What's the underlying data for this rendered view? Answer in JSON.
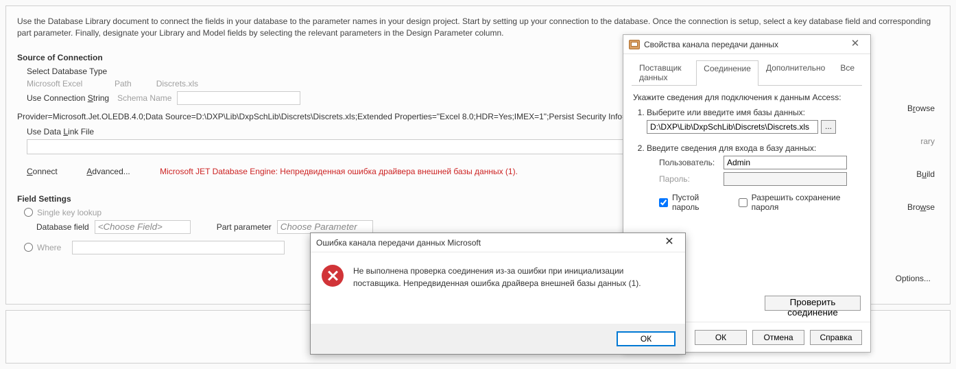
{
  "intro": "Use the Database Library document to connect the fields in your database to the parameter names in your design project. Start by setting up your connection to the database. Once the connection is setup, select a key database field and corresponding part parameter. Finally, designate your Library and Model fields by selecting the relevant parameters in the Design Parameter column.",
  "source": {
    "heading": "Source of Connection",
    "select_db_type": "Select Database Type",
    "provider_label": "Microsoft Excel",
    "path_label": "Path",
    "path_value": "Discrets.xls",
    "use_conn_string": "Use Connection String",
    "schema_label": "Schema Name",
    "conn_string": "Provider=Microsoft.Jet.OLEDB.4.0;Data Source=D:\\DXP\\Lib\\DxpSchLib\\Discrets\\Discrets.xls;Extended Properties=\"Excel 8.0;HDR=Yes;IMEX=1\";Persist Security Info=False",
    "use_data_link": "Use Data Link File",
    "connect": "Connect",
    "advanced": "Advanced...",
    "error": "Microsoft JET Database Engine: Непредвиденная ошибка драйвера внешней базы данных (1).",
    "links_underline": {
      "connect": "C",
      "advanced": "A"
    }
  },
  "right": {
    "browse": "Browse",
    "rary": "rary",
    "build": "Build",
    "options": "Options..."
  },
  "fields": {
    "heading": "Field Settings",
    "single_key": "Single key lookup",
    "db_field": "Database field",
    "db_field_ph": "<Choose Field>",
    "part_param": "Part parameter",
    "part_param_ph": "Choose Parameter",
    "where": "Where"
  },
  "props_dlg": {
    "title": "Свойства канала передачи данных",
    "tabs": [
      "Поставщик данных",
      "Соединение",
      "Дополнительно",
      "Все"
    ],
    "active_tab": 1,
    "instr": "Укажите сведения для подключения к данным Access:",
    "step1": "Выберите или введите имя базы данных:",
    "db_value": "D:\\DXP\\Lib\\DxpSchLib\\Discrets\\Discrets.xls",
    "browse_dots": "...",
    "step2": "Введите сведения для входа в базу данных:",
    "user_label": "Пользователь:",
    "user_value": "Admin",
    "pwd_label": "Пароль:",
    "blank_pwd": "Пустой пароль",
    "allow_save": "Разрешить сохранение пароля",
    "test_btn": "Проверить соединение",
    "ok": "ОК",
    "cancel": "Отмена",
    "help": "Справка"
  },
  "err_dlg": {
    "title": "Ошибка канала передачи данных Microsoft",
    "msg": "Не выполнена проверка соединения из-за ошибки при инициализации поставщика. Непредвиденная ошибка драйвера внешней базы данных (1).",
    "ok": "ОК"
  }
}
